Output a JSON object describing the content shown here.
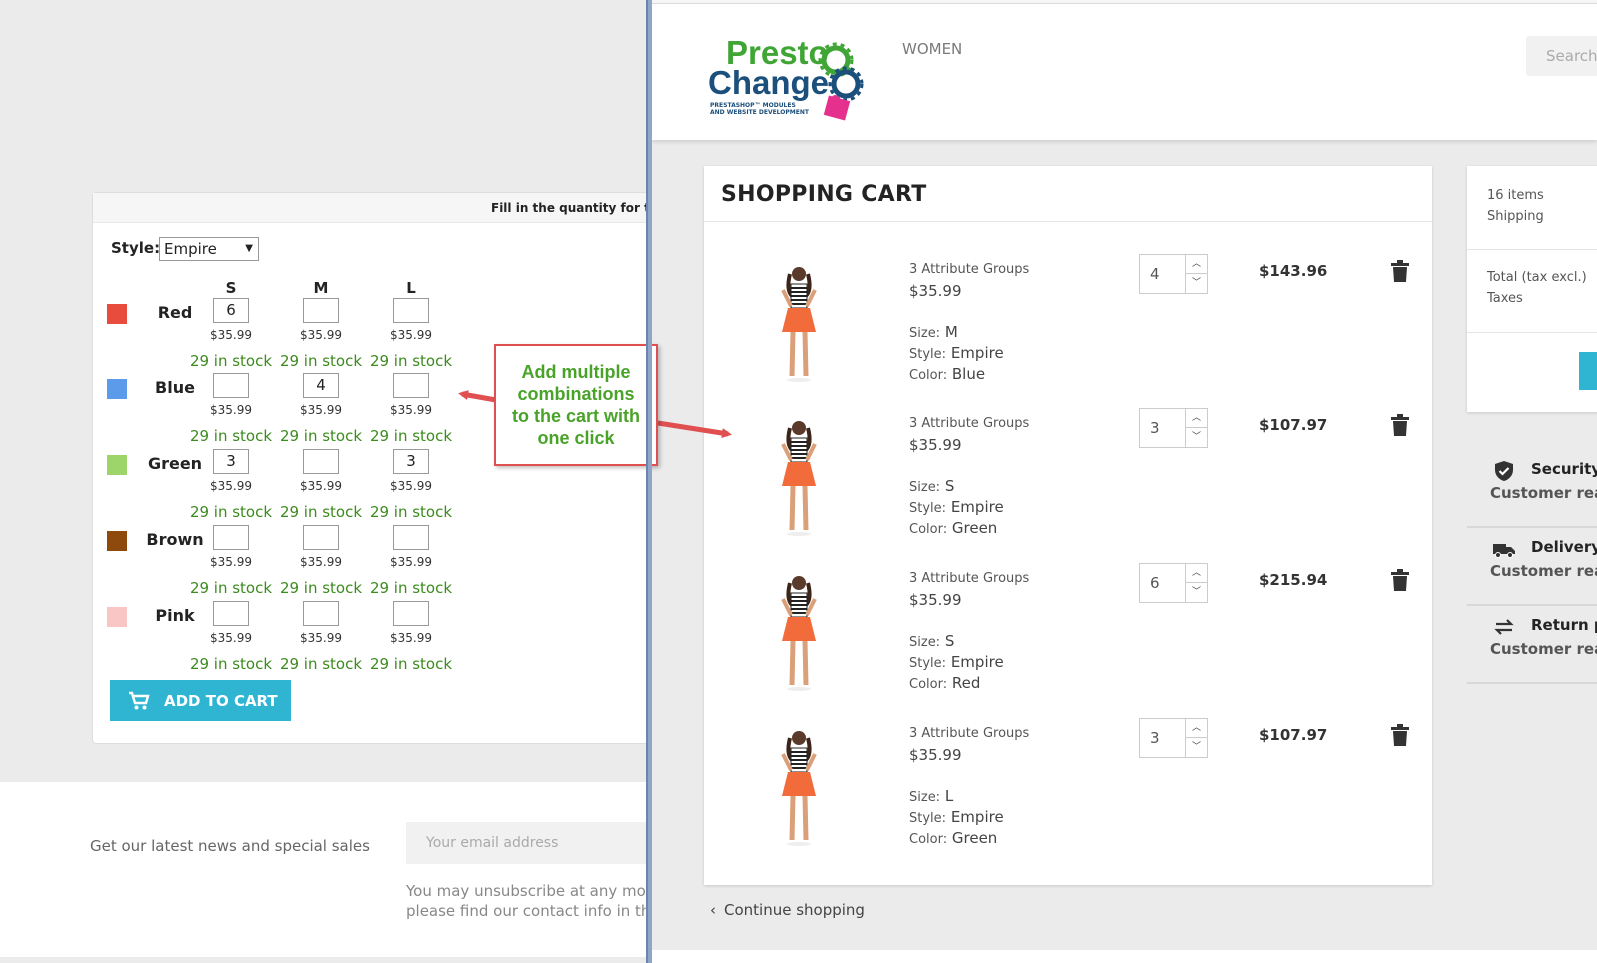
{
  "left": {
    "fill_header": "Fill in the quantity for the",
    "style_label": "Style:",
    "style_value": "Empire",
    "sizes": [
      "S",
      "M",
      "L"
    ],
    "rows": [
      {
        "color": "Red",
        "swatch": "#e74c3c",
        "qty": [
          "6",
          "",
          ""
        ],
        "price": "$35.99",
        "stock": "29 in stock"
      },
      {
        "color": "Blue",
        "swatch": "#5b9bea",
        "qty": [
          "",
          "4",
          ""
        ],
        "price": "$35.99",
        "stock": "29 in stock"
      },
      {
        "color": "Green",
        "swatch": "#9ed56a",
        "qty": [
          "3",
          "",
          "3"
        ],
        "price": "$35.99",
        "stock": "29 in stock"
      },
      {
        "color": "Brown",
        "swatch": "#8e4a0c",
        "qty": [
          "",
          "",
          ""
        ],
        "price": "$35.99",
        "stock": "29 in stock"
      },
      {
        "color": "Pink",
        "swatch": "#f9c5c5",
        "qty": [
          "",
          "",
          ""
        ],
        "price": "$35.99",
        "stock": "29 in stock"
      }
    ],
    "add_to_cart": "ADD TO CART",
    "newsletter": "Get our latest news and special sales",
    "email_placeholder": "Your email address",
    "unsubscribe_1": "You may unsubscribe at any mom",
    "unsubscribe_2": "please find our contact info in the"
  },
  "callout": {
    "line1": "Add multiple",
    "line2": "combinations",
    "line3": "to the cart with",
    "line4": "one click"
  },
  "header": {
    "logo_top": "Presto",
    "logo_bottom": "Change",
    "logo_tag1": "PRESTASHOP™ MODULES",
    "logo_tag2": "AND WEBSITE DEVELOPMENT",
    "nav_women": "WOMEN",
    "search_placeholder": "Search"
  },
  "cart": {
    "title": "SHOPPING CART",
    "items": [
      {
        "name": "3 Attribute Groups",
        "price": "$35.99",
        "size_label": "Size:",
        "size": "M",
        "style_label": "Style:",
        "style": "Empire",
        "color_label": "Color:",
        "color": "Blue",
        "qty": "4",
        "total": "$143.96"
      },
      {
        "name": "3 Attribute Groups",
        "price": "$35.99",
        "size_label": "Size:",
        "size": "S",
        "style_label": "Style:",
        "style": "Empire",
        "color_label": "Color:",
        "color": "Green",
        "qty": "3",
        "total": "$107.97"
      },
      {
        "name": "3 Attribute Groups",
        "price": "$35.99",
        "size_label": "Size:",
        "size": "S",
        "style_label": "Style:",
        "style": "Empire",
        "color_label": "Color:",
        "color": "Red",
        "qty": "6",
        "total": "$215.94"
      },
      {
        "name": "3 Attribute Groups",
        "price": "$35.99",
        "size_label": "Size:",
        "size": "L",
        "style_label": "Style:",
        "style": "Empire",
        "color_label": "Color:",
        "color": "Green",
        "qty": "3",
        "total": "$107.97"
      }
    ],
    "continue": "Continue shopping"
  },
  "summary": {
    "items": "16 items",
    "shipping": "Shipping",
    "total": "Total (tax excl.)",
    "taxes": "Taxes"
  },
  "reassurance": [
    {
      "title": "Security p",
      "sub": "Customer reas",
      "icon": "shield-icon"
    },
    {
      "title": "Delivery p",
      "sub": "Customer reas",
      "icon": "truck-icon"
    },
    {
      "title": "Return po",
      "sub": "Customer reas",
      "icon": "exchange-icon"
    }
  ],
  "colors": {
    "accent": "#2fb5d2",
    "stock_green": "#3c8b1e",
    "callout_red": "#e05050",
    "callout_green": "#49a329"
  }
}
